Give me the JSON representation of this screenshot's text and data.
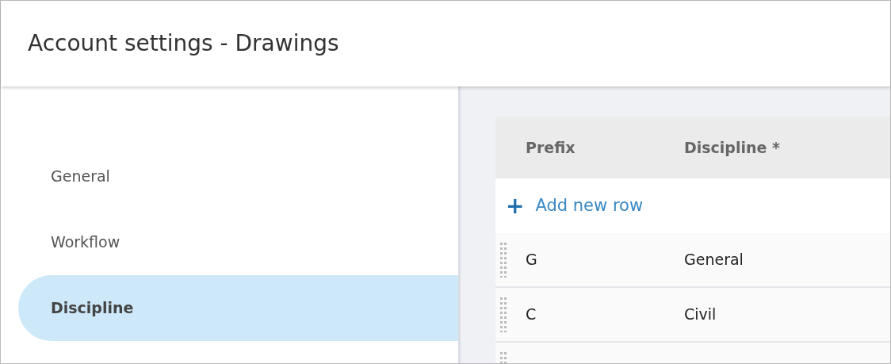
{
  "window": {
    "title": "Account settings - Drawings"
  },
  "sidebar": {
    "items": [
      {
        "label": "General",
        "selected": false
      },
      {
        "label": "Workflow",
        "selected": false
      },
      {
        "label": "Discipline",
        "selected": true
      }
    ]
  },
  "table": {
    "columns": [
      "Prefix",
      "Discipline *"
    ],
    "add_row": {
      "icon": "+",
      "label": "Add new row"
    },
    "rows": [
      {
        "prefix": "G",
        "discipline": "General"
      },
      {
        "prefix": "C",
        "discipline": "Civil"
      }
    ]
  }
}
